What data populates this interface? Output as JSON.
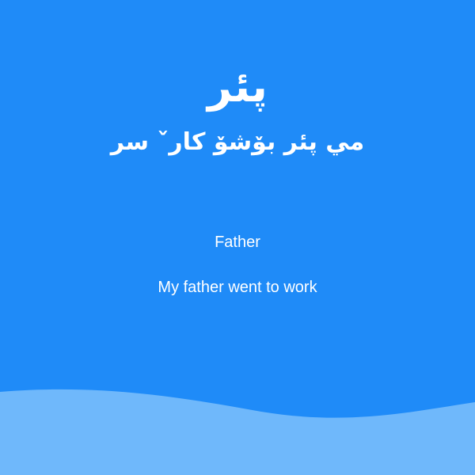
{
  "card": {
    "word": "پئر",
    "sentence": "مي پئر بۆشۆ كارˇ سر",
    "translation": "Father",
    "sentence_translation": "My father went to work"
  },
  "colors": {
    "background": "#1f8bf8",
    "wave": "#6fb8fb"
  }
}
